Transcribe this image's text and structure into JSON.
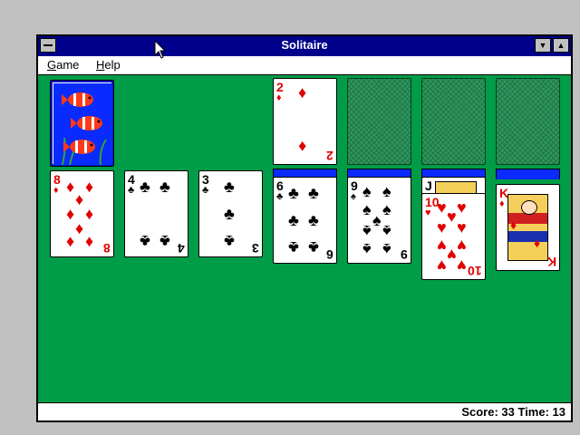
{
  "window": {
    "title": "Solitaire"
  },
  "menu": {
    "game": "Game",
    "help": "Help"
  },
  "status": {
    "text": "Score: 33 Time: 13"
  },
  "stock": {
    "back_design": "fish-aquarium"
  },
  "waste": {
    "rank": "2",
    "suit": "♦",
    "color": "red"
  },
  "foundations": [
    "empty",
    "empty",
    "empty"
  ],
  "tableau": [
    {
      "rank": "8",
      "suit": "♦",
      "color": "red",
      "facedown": 0
    },
    {
      "rank": "4",
      "suit": "♣",
      "color": "black",
      "facedown": 0
    },
    {
      "rank": "3",
      "suit": "♣",
      "color": "black",
      "facedown": 0
    },
    {
      "rank": "6",
      "suit": "♣",
      "color": "black",
      "facedown": 1
    },
    {
      "rank": "9",
      "suit": "♠",
      "color": "black",
      "facedown": 1
    },
    {
      "rank": "10",
      "suit": "♥",
      "color": "red",
      "facedown": 1,
      "under_rank": "J"
    },
    {
      "rank": "K",
      "suit": "♦",
      "color": "red",
      "facedown": 1
    }
  ],
  "colors": {
    "table": "#009c47",
    "titlebar": "#00008b",
    "card_red": "#e00000"
  }
}
